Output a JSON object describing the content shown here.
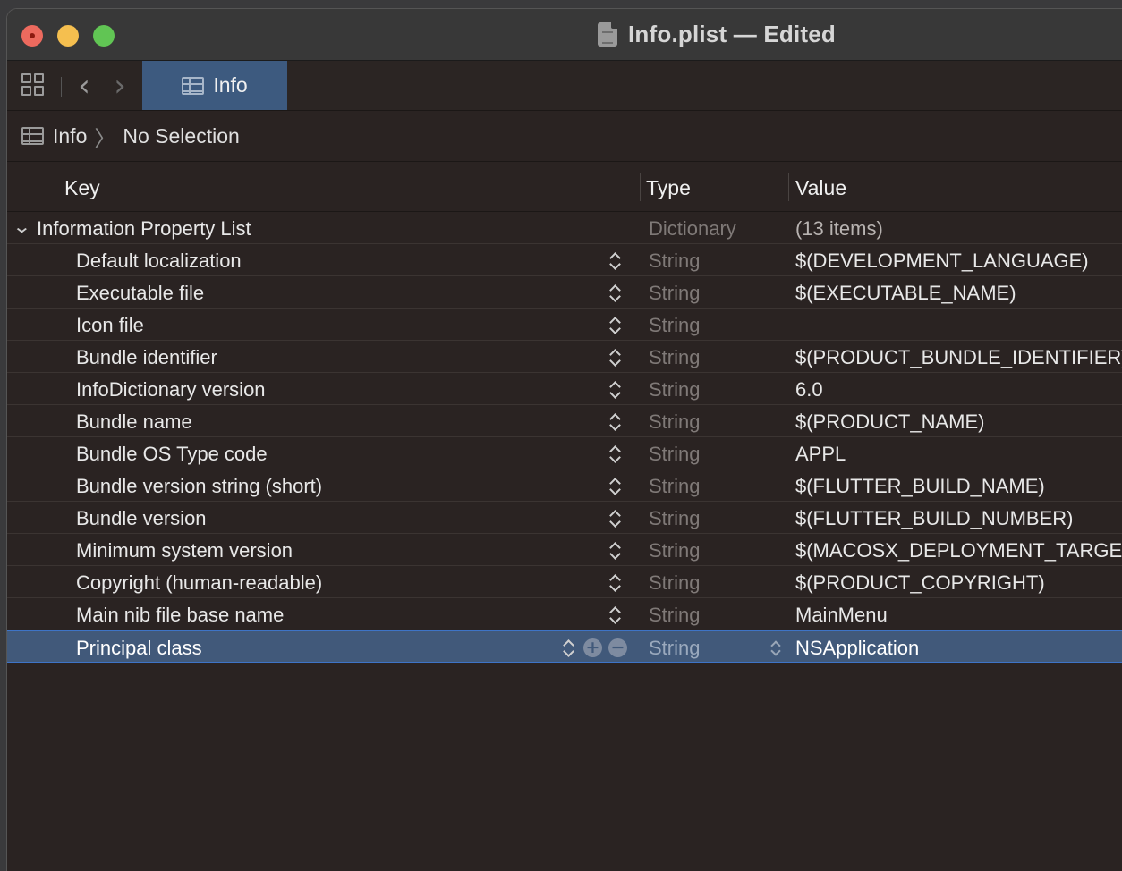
{
  "window": {
    "title": "Info.plist — Edited"
  },
  "tabbar": {
    "active_tab": "Info"
  },
  "jumpbar": {
    "items": [
      "Info",
      "No Selection"
    ]
  },
  "columns": {
    "key": "Key",
    "type": "Type",
    "value": "Value"
  },
  "root": {
    "key": "Information Property List",
    "type": "Dictionary",
    "value": "(13 items)"
  },
  "rows": [
    {
      "key": "Default localization",
      "type": "String",
      "value": "$(DEVELOPMENT_LANGUAGE)"
    },
    {
      "key": "Executable file",
      "type": "String",
      "value": "$(EXECUTABLE_NAME)"
    },
    {
      "key": "Icon file",
      "type": "String",
      "value": ""
    },
    {
      "key": "Bundle identifier",
      "type": "String",
      "value": "$(PRODUCT_BUNDLE_IDENTIFIER)"
    },
    {
      "key": "InfoDictionary version",
      "type": "String",
      "value": "6.0"
    },
    {
      "key": "Bundle name",
      "type": "String",
      "value": "$(PRODUCT_NAME)"
    },
    {
      "key": "Bundle OS Type code",
      "type": "String",
      "value": "APPL"
    },
    {
      "key": "Bundle version string (short)",
      "type": "String",
      "value": "$(FLUTTER_BUILD_NAME)"
    },
    {
      "key": "Bundle version",
      "type": "String",
      "value": "$(FLUTTER_BUILD_NUMBER)"
    },
    {
      "key": "Minimum system version",
      "type": "String",
      "value": "$(MACOSX_DEPLOYMENT_TARGET)"
    },
    {
      "key": "Copyright (human-readable)",
      "type": "String",
      "value": "$(PRODUCT_COPYRIGHT)"
    },
    {
      "key": "Main nib file base name",
      "type": "String",
      "value": "MainMenu"
    },
    {
      "key": "Principal class",
      "type": "String",
      "value": "NSApplication"
    }
  ],
  "selected_row": 12,
  "colors": {
    "selection": "#41597a",
    "tab_active": "#3d5a7f",
    "close": "#ed6a5e",
    "minimize": "#f5bf4f",
    "maximize": "#61c554"
  }
}
